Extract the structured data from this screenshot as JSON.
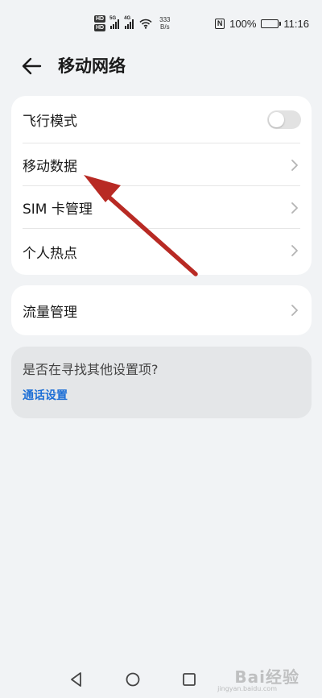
{
  "status_bar": {
    "hd1": "HD",
    "hd2": "HD",
    "net1": "5G",
    "net2": "4G",
    "speed_value": "333",
    "speed_unit": "B/s",
    "nfc": "N",
    "battery": "100%",
    "time": "11:16"
  },
  "header": {
    "title": "移动网络"
  },
  "settings_main": {
    "items": [
      {
        "label": "飞行模式",
        "control": "toggle",
        "toggle_on": false
      },
      {
        "label": "移动数据",
        "control": "chevron"
      },
      {
        "label": "SIM 卡管理",
        "control": "chevron"
      },
      {
        "label": "个人热点",
        "control": "chevron"
      }
    ]
  },
  "settings_traffic": {
    "items": [
      {
        "label": "流量管理",
        "control": "chevron"
      }
    ]
  },
  "suggestion": {
    "question": "是否在寻找其他设置项?",
    "link": "通话设置"
  },
  "annotation": {
    "icon": "red-arrow-icon",
    "color": "#b82a24"
  },
  "nav_bar": {
    "back_icon": "triangle-back-icon",
    "home_icon": "circle-home-icon",
    "recents_icon": "square-recents-icon"
  },
  "watermark": {
    "text": "Bai经验",
    "sub": "jingyan.baidu.com"
  },
  "colors": {
    "background": "#f1f3f5",
    "card": "#ffffff",
    "link": "#1d6fd6"
  }
}
